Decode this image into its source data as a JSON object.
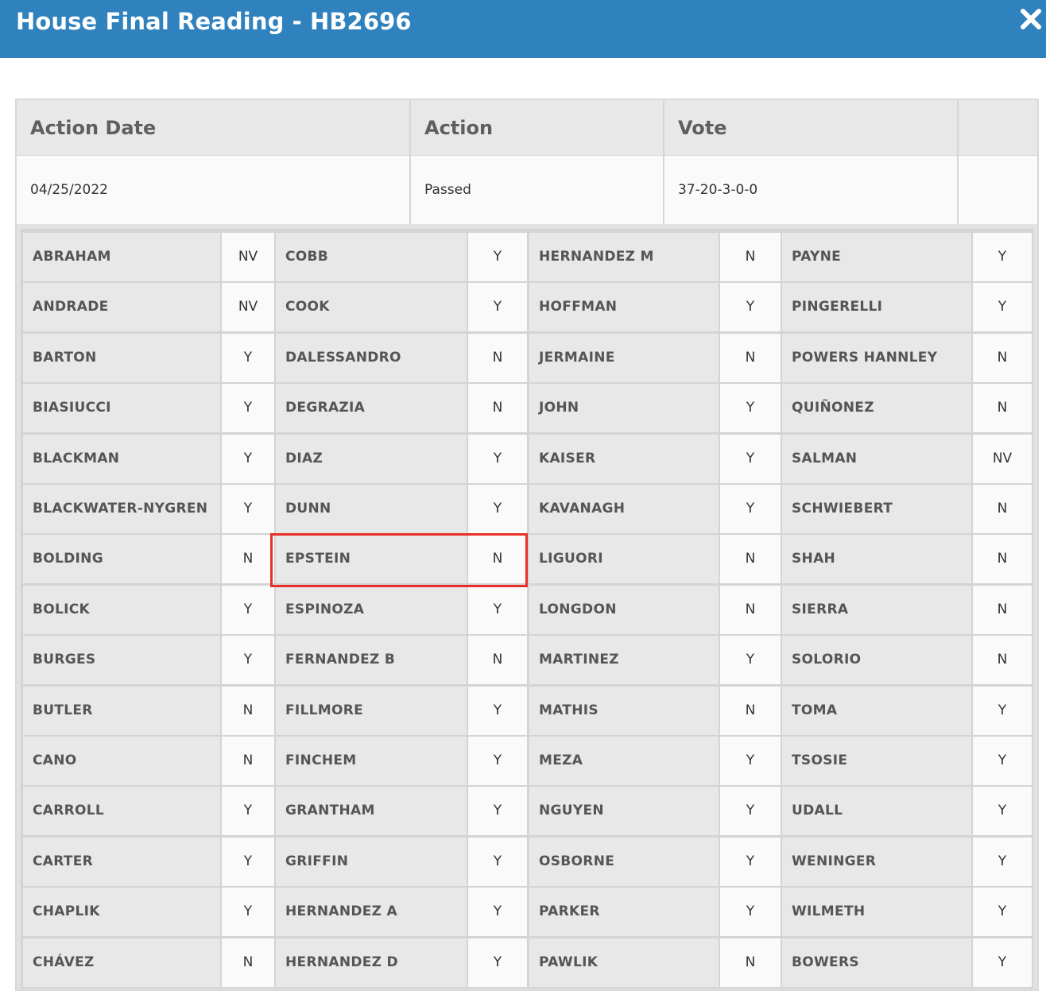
{
  "dialog": {
    "title": "House Final Reading - HB2696",
    "close_icon": "close-icon"
  },
  "summary": {
    "headers": [
      "Action Date",
      "Action",
      "Vote",
      ""
    ],
    "row": [
      "04/25/2022",
      "Passed",
      "37-20-3-0-0",
      ""
    ]
  },
  "votes": {
    "columns": [
      [
        {
          "name": "ABRAHAM",
          "vote": "NV"
        },
        {
          "name": "ANDRADE",
          "vote": "NV"
        },
        {
          "name": "BARTON",
          "vote": "Y"
        },
        {
          "name": "BIASIUCCI",
          "vote": "Y"
        },
        {
          "name": "BLACKMAN",
          "vote": "Y"
        },
        {
          "name": "BLACKWATER-NYGREN",
          "vote": "Y"
        },
        {
          "name": "BOLDING",
          "vote": "N"
        },
        {
          "name": "BOLICK",
          "vote": "Y"
        },
        {
          "name": "BURGES",
          "vote": "Y"
        },
        {
          "name": "BUTLER",
          "vote": "N"
        },
        {
          "name": "CANO",
          "vote": "N"
        },
        {
          "name": "CARROLL",
          "vote": "Y"
        },
        {
          "name": "CARTER",
          "vote": "Y"
        },
        {
          "name": "CHAPLIK",
          "vote": "Y"
        },
        {
          "name": "CHÁVEZ",
          "vote": "N"
        }
      ],
      [
        {
          "name": "COBB",
          "vote": "Y"
        },
        {
          "name": "COOK",
          "vote": "Y"
        },
        {
          "name": "DALESSANDRO",
          "vote": "N"
        },
        {
          "name": "DEGRAZIA",
          "vote": "N"
        },
        {
          "name": "DIAZ",
          "vote": "Y"
        },
        {
          "name": "DUNN",
          "vote": "Y"
        },
        {
          "name": "EPSTEIN",
          "vote": "N"
        },
        {
          "name": "ESPINOZA",
          "vote": "Y"
        },
        {
          "name": "FERNANDEZ B",
          "vote": "N"
        },
        {
          "name": "FILLMORE",
          "vote": "Y"
        },
        {
          "name": "FINCHEM",
          "vote": "Y"
        },
        {
          "name": "GRANTHAM",
          "vote": "Y"
        },
        {
          "name": "GRIFFIN",
          "vote": "Y"
        },
        {
          "name": "HERNANDEZ A",
          "vote": "Y"
        },
        {
          "name": "HERNANDEZ D",
          "vote": "Y"
        }
      ],
      [
        {
          "name": "HERNANDEZ M",
          "vote": "N"
        },
        {
          "name": "HOFFMAN",
          "vote": "Y"
        },
        {
          "name": "JERMAINE",
          "vote": "N"
        },
        {
          "name": "JOHN",
          "vote": "Y"
        },
        {
          "name": "KAISER",
          "vote": "Y"
        },
        {
          "name": "KAVANAGH",
          "vote": "Y"
        },
        {
          "name": "LIGUORI",
          "vote": "N"
        },
        {
          "name": "LONGDON",
          "vote": "N"
        },
        {
          "name": "MARTINEZ",
          "vote": "Y"
        },
        {
          "name": "MATHIS",
          "vote": "N"
        },
        {
          "name": "MEZA",
          "vote": "Y"
        },
        {
          "name": "NGUYEN",
          "vote": "Y"
        },
        {
          "name": "OSBORNE",
          "vote": "Y"
        },
        {
          "name": "PARKER",
          "vote": "Y"
        },
        {
          "name": "PAWLIK",
          "vote": "N"
        }
      ],
      [
        {
          "name": "PAYNE",
          "vote": "Y"
        },
        {
          "name": "PINGERELLI",
          "vote": "Y"
        },
        {
          "name": "POWERS HANNLEY",
          "vote": "N"
        },
        {
          "name": "QUIÑONEZ",
          "vote": "N"
        },
        {
          "name": "SALMAN",
          "vote": "NV"
        },
        {
          "name": "SCHWIEBERT",
          "vote": "N"
        },
        {
          "name": "SHAH",
          "vote": "N"
        },
        {
          "name": "SIERRA",
          "vote": "N"
        },
        {
          "name": "SOLORIO",
          "vote": "N"
        },
        {
          "name": "TOMA",
          "vote": "Y"
        },
        {
          "name": "TSOSIE",
          "vote": "Y"
        },
        {
          "name": "UDALL",
          "vote": "Y"
        },
        {
          "name": "WENINGER",
          "vote": "Y"
        },
        {
          "name": "WILMETH",
          "vote": "Y"
        },
        {
          "name": "BOWERS",
          "vote": "Y"
        }
      ]
    ],
    "highlighted": {
      "column": 1,
      "row": 6
    }
  },
  "colors": {
    "title_bar": "#2f82bd",
    "highlight_border": "#e8302a"
  }
}
